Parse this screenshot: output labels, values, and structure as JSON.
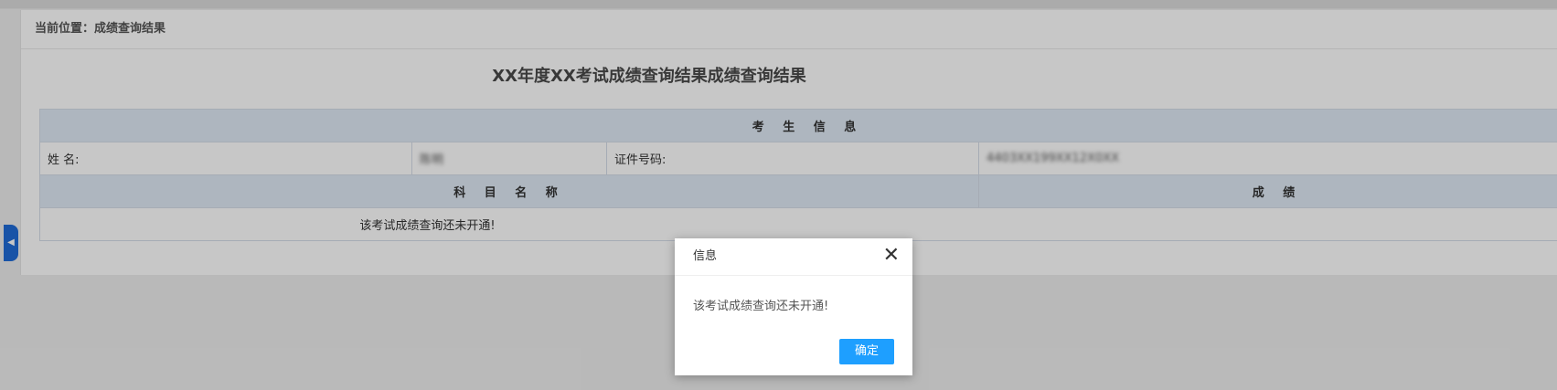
{
  "breadcrumb": "当前位置：成绩查询结果",
  "title": "XX年度XX考试成绩查询结果成绩查询结果",
  "section_header": "考 生 信 息",
  "info": {
    "name_label": "姓    名:",
    "name_value": "陈明",
    "id_label": "证件号码:",
    "id_value": "4403XX199XX12X0XX"
  },
  "table": {
    "col_subject": "科 目 名 称",
    "col_score": "成 绩",
    "empty_message": "该考试成绩查询还未开通!"
  },
  "dialog": {
    "title": "信息",
    "message": "该考试成绩查询还未开通!",
    "ok_label": "确定"
  },
  "colors": {
    "accent": "#1e9fff",
    "side_tab": "#1f6bd6",
    "header_bg": "#dfe9f5"
  },
  "icons": {
    "close": "close-icon",
    "side_toggle": "chevron-left-icon"
  }
}
